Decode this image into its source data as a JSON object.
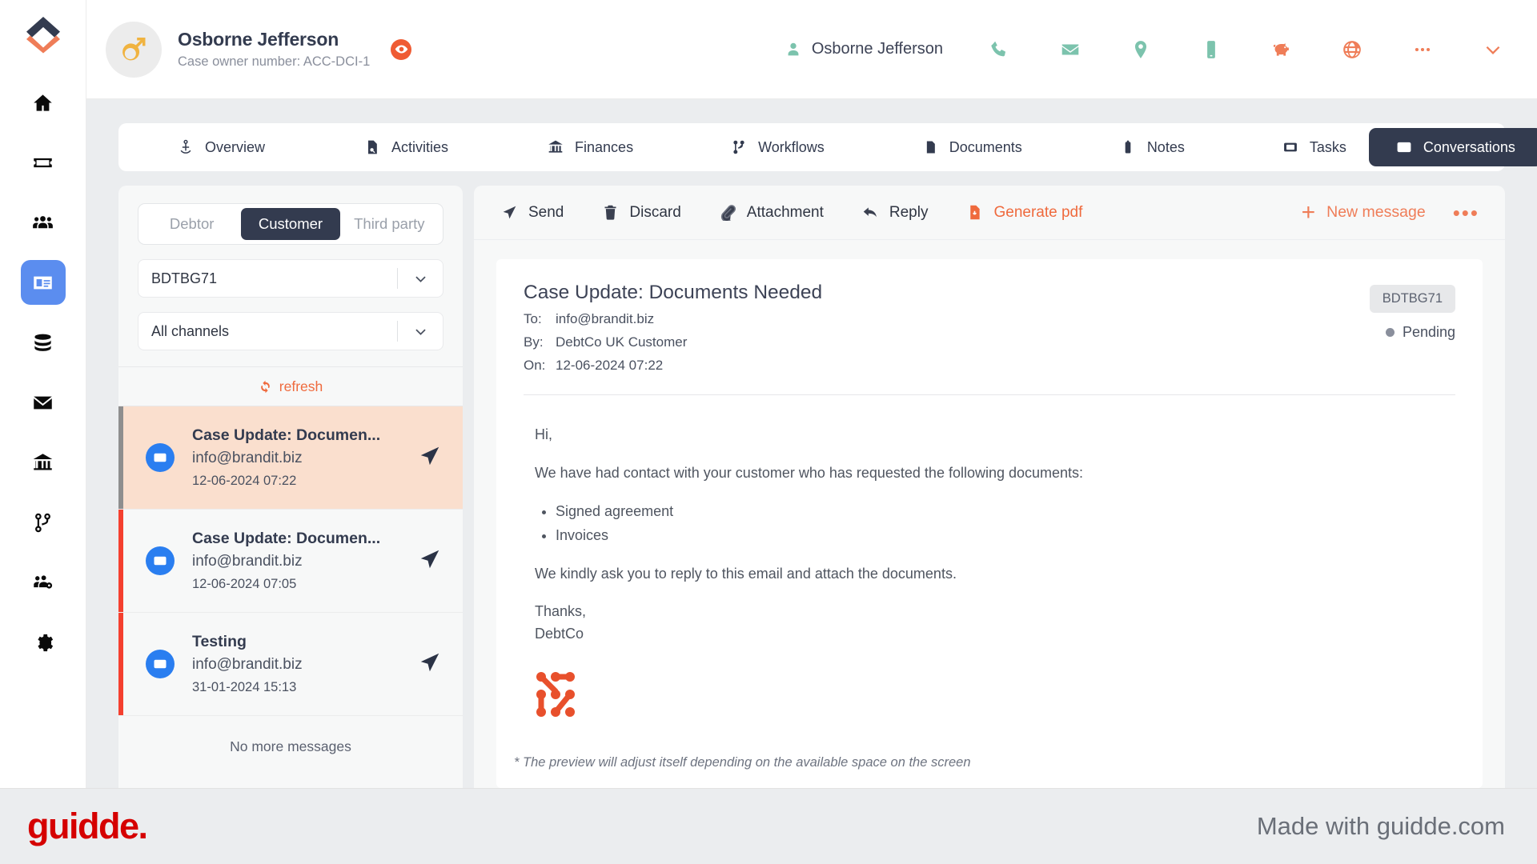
{
  "sidebar": {
    "logo": "guidde-logo-icon",
    "items": [
      {
        "name": "home",
        "icon": "home-icon",
        "active": false
      },
      {
        "name": "cases",
        "icon": "ticket-icon",
        "active": false
      },
      {
        "name": "people",
        "icon": "users-icon",
        "active": false
      },
      {
        "name": "contacts",
        "icon": "id-card-icon",
        "active": true
      },
      {
        "name": "database",
        "icon": "database-icon",
        "active": false
      },
      {
        "name": "mail",
        "icon": "envelope-icon",
        "active": false
      },
      {
        "name": "bank",
        "icon": "bank-icon",
        "active": false
      },
      {
        "name": "workflows",
        "icon": "git-branch-icon",
        "active": false
      },
      {
        "name": "team",
        "icon": "users-cog-icon",
        "active": false
      },
      {
        "name": "settings",
        "icon": "gear-icon",
        "active": false
      }
    ]
  },
  "header": {
    "avatar_icon": "male-gender-icon",
    "case_name": "Osborne Jefferson",
    "case_sub": "Case owner number: ACC-DCI-1",
    "eye_badge_icon": "eye-icon",
    "user_name": "Osborne Jefferson",
    "user_icon": "person-icon",
    "icons": [
      {
        "name": "phone-icon",
        "color": "#7cc3ad"
      },
      {
        "name": "email-icon",
        "color": "#7cc3ad"
      },
      {
        "name": "location-pin-icon",
        "color": "#7cc3ad"
      },
      {
        "name": "mobile-icon",
        "color": "#7cc3ad"
      },
      {
        "name": "piggy-bank-icon",
        "color": "#ef7d58"
      },
      {
        "name": "globe-icon",
        "color": "#ef7d58"
      },
      {
        "name": "more-dots-icon",
        "color": "#ef7d58"
      },
      {
        "name": "chevron-down-icon",
        "color": "#ef7d58"
      }
    ]
  },
  "tabs": [
    {
      "label": "Overview",
      "icon": "anchor-icon",
      "active": false
    },
    {
      "label": "Activities",
      "icon": "document-search-icon",
      "active": false
    },
    {
      "label": "Finances",
      "icon": "bank-icon",
      "active": false
    },
    {
      "label": "Workflows",
      "icon": "git-branch-icon",
      "active": false
    },
    {
      "label": "Documents",
      "icon": "folder-icon",
      "active": false
    },
    {
      "label": "Notes",
      "icon": "note-icon",
      "active": false
    },
    {
      "label": "Tasks",
      "icon": "tasks-icon",
      "active": false
    },
    {
      "label": "Conversations",
      "icon": "envelope-icon",
      "active": true
    }
  ],
  "list_pane": {
    "segments": [
      {
        "label": "Debtor",
        "active": false
      },
      {
        "label": "Customer",
        "active": true
      },
      {
        "label": "Third party",
        "active": false
      }
    ],
    "case_select": {
      "value": "BDTBG71",
      "icon": "chevron-down-icon"
    },
    "channel_select": {
      "value": "All channels",
      "icon": "chevron-down-icon"
    },
    "refresh": {
      "label": "refresh",
      "icon": "refresh-icon"
    },
    "messages": [
      {
        "subject": "Case Update: Documen...",
        "from": "info@brandit.biz",
        "date": "12-06-2024 07:22",
        "icon": "envelope-icon",
        "send_icon": "send-icon",
        "selected": true,
        "bar_color": "#8e8e8e"
      },
      {
        "subject": "Case Update: Documen...",
        "from": "info@brandit.biz",
        "date": "12-06-2024 07:05",
        "icon": "envelope-icon",
        "send_icon": "send-icon",
        "selected": false,
        "bar_color": "#f4402f"
      },
      {
        "subject": "Testing",
        "from": "info@brandit.biz",
        "date": "31-01-2024 15:13",
        "icon": "envelope-icon",
        "send_icon": "send-icon",
        "selected": false,
        "bar_color": "#f4402f"
      }
    ],
    "no_more": "No more messages"
  },
  "toolbar": {
    "send_label": "Send",
    "discard_label": "Discard",
    "attachment_label": "Attachment",
    "reply_label": "Reply",
    "generate_pdf_label": "Generate pdf",
    "new_message_label": "New message",
    "new_message_plus": "+",
    "more_dots": "•••"
  },
  "email": {
    "subject": "Case Update: Documents Needed",
    "to_label": "To:",
    "to_value": "info@brandit.biz",
    "by_label": "By:",
    "by_value": "DebtCo UK Customer",
    "on_label": "On:",
    "on_value": "12-06-2024 07:22",
    "chip": "BDTBG71",
    "status": "Pending",
    "status_color": "#8a8f9c",
    "greeting": "Hi,",
    "intro": "We have had contact with your customer who has requested the following documents:",
    "documents": [
      "Signed agreement",
      "Invoices"
    ],
    "request": "We kindly ask you to reply to this email and attach the documents.",
    "sign_off": "Thanks,",
    "sign_name": "DebtCo",
    "signature_logo_icon": "network-nodes-logo-icon",
    "footnote": "* The preview will adjust itself depending on the available space on the screen"
  },
  "brand": {
    "left": "guidde.",
    "right": "Made with guidde.com",
    "color": "#d50000"
  }
}
